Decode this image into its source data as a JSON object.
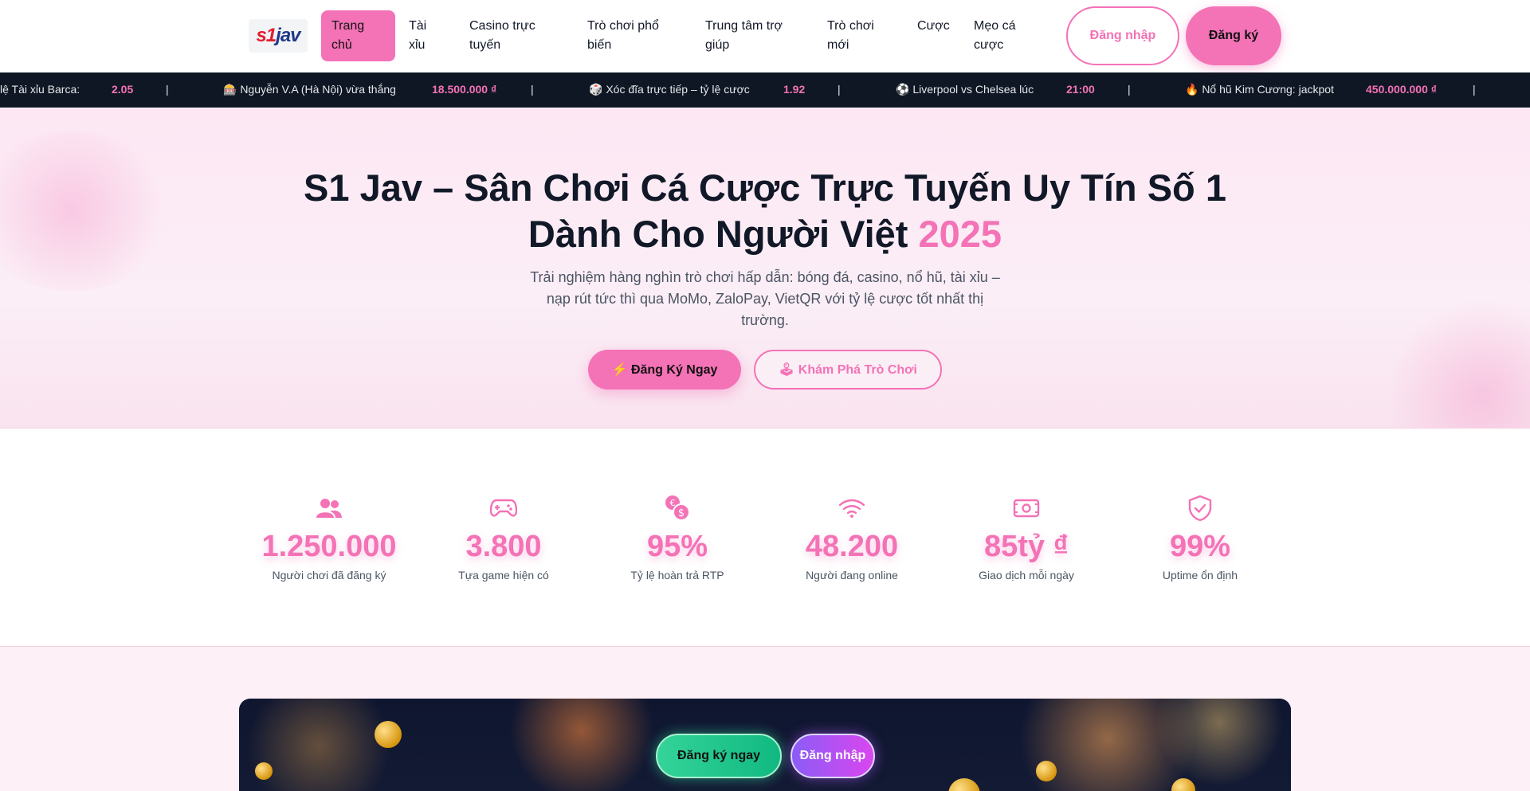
{
  "brand": {
    "logo_s1": "s1",
    "logo_jav": "jav"
  },
  "nav": {
    "items": [
      {
        "label": "Trang chủ"
      },
      {
        "label": "Tài xỉu"
      },
      {
        "label": "Casino trực tuyến"
      },
      {
        "label": "Trò chơi phổ biến"
      },
      {
        "label": "Trung tâm trợ giúp"
      },
      {
        "label": "Trò chơi mới"
      },
      {
        "label": "Cược"
      },
      {
        "label": "Mẹo cá cược"
      }
    ],
    "login_label": "Đăng nhập",
    "register_label": "Đăng ký"
  },
  "ticker": {
    "items": [
      {
        "text": "lệ Tài xỉu Barca:",
        "value": "2.05"
      },
      {
        "text": "🎰 Nguyễn V.A (Hà Nội) vừa thắng",
        "value": "18.500.000 ₫"
      },
      {
        "text": "🎲 Xóc đĩa trực tiếp – tỷ lệ cược",
        "value": "1.92"
      },
      {
        "text": "⚽ Liverpool vs Chelsea lúc",
        "value": "21:00"
      },
      {
        "text": "🔥 Nổ hũ Kim Cương: jackpot",
        "value": "450.000.000 ₫"
      }
    ],
    "separator": "|"
  },
  "hero": {
    "title_main": "S1 Jav – Sân Chơi Cá Cược Trực Tuyến Uy Tín Số 1 Dành Cho Người Việt",
    "title_year": "2025",
    "subtitle": "Trải nghiệm hàng nghìn trò chơi hấp dẫn: bóng đá, casino, nổ hũ, tài xỉu – nạp rút tức thì qua MoMo, ZaloPay, VietQR với tỷ lệ cược tốt nhất thị trường.",
    "primary_cta": "⚡ Đăng Ký Ngay",
    "secondary_cta": "🕹 Khám Phá Trò Chơi"
  },
  "stats": [
    {
      "icon": "users-icon",
      "value": "1.250.000",
      "label": "Người chơi đã đăng ký"
    },
    {
      "icon": "gamepad-icon",
      "value": "3.800",
      "label": "Tựa game hiện có"
    },
    {
      "icon": "coins-icon",
      "value": "95%",
      "label": "Tỷ lệ hoàn trả RTP"
    },
    {
      "icon": "wifi-icon",
      "value": "48.200",
      "label": "Người đang online"
    },
    {
      "icon": "money-icon",
      "value": "85tỷ ₫",
      "label": "Giao dịch mỗi ngày"
    },
    {
      "icon": "shield-check-icon",
      "value": "99%",
      "label": "Uptime ổn định"
    }
  ],
  "banner": {
    "register_label": "Đăng ký ngay",
    "login_label": "Đăng nhập"
  },
  "colors": {
    "accent": "#f472b6",
    "ticker_bg": "#0f1724",
    "text_dark": "#111827"
  }
}
